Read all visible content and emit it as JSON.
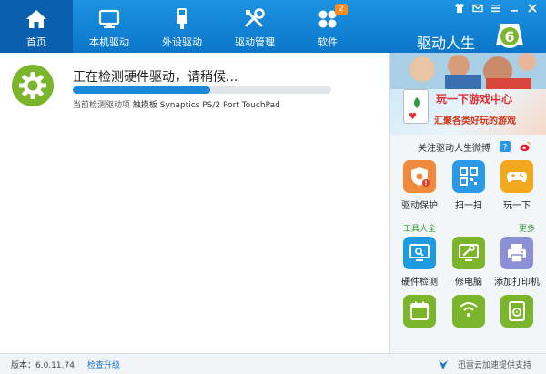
{
  "nav": {
    "items": [
      {
        "label": "首页",
        "icon": "home-icon"
      },
      {
        "label": "本机驱动",
        "icon": "monitor-icon"
      },
      {
        "label": "外设驱动",
        "icon": "usb-icon"
      },
      {
        "label": "驱动管理",
        "icon": "tools-icon"
      },
      {
        "label": "软件",
        "icon": "apps-icon",
        "badge": "2"
      }
    ],
    "active_index": 0
  },
  "window_buttons": [
    "shirt-icon",
    "mail-icon",
    "menu-icon",
    "minimize-icon",
    "close-icon"
  ],
  "brand": {
    "name": "驱动人生",
    "logo_text": "6"
  },
  "scan": {
    "title": "正在检测硬件驱动，请稍候...",
    "progress": 0.53,
    "status_label": "当前检测驱动项",
    "status_value": "触摸板 Synaptics PS/2 Port TouchPad"
  },
  "side": {
    "banner": {
      "title": "玩一下游戏中心",
      "subtitle": "汇聚各类好玩的游戏"
    },
    "follow_text": "关注驱动人生微博",
    "tools_top": [
      {
        "label": "驱动保护",
        "icon": "shield-icon",
        "color": "#f08a3c"
      },
      {
        "label": "扫一扫",
        "icon": "qrcode-icon",
        "color": "#2a9ae8"
      },
      {
        "label": "玩一下",
        "icon": "gamepad-icon",
        "color": "#f2a81d"
      }
    ],
    "section": {
      "title": "工具大全",
      "more": "更多"
    },
    "tools_bottom": [
      {
        "label": "硬件检测",
        "icon": "hardware-check-icon",
        "color": "#1e9be0"
      },
      {
        "label": "修电脑",
        "icon": "repair-icon",
        "color": "#7ab52b"
      },
      {
        "label": "添加打印机",
        "icon": "printer-icon",
        "color": "#8a8fd6"
      }
    ],
    "tools_partial": [
      {
        "icon": "calendar-icon",
        "color": "#7ab52b"
      },
      {
        "icon": "wifi-icon",
        "color": "#7ab52b"
      },
      {
        "icon": "disk-icon",
        "color": "#7ab52b"
      }
    ]
  },
  "footer": {
    "version": "版本：6.0.11.74",
    "update_link": "检查升级",
    "xunlei_text": "迅雷云加速提供支持"
  },
  "colors": {
    "nav_bg": "#1283d6",
    "nav_active": "#0a5fae",
    "accent_green": "#7ab52b",
    "progress": "#1a8ad8"
  }
}
